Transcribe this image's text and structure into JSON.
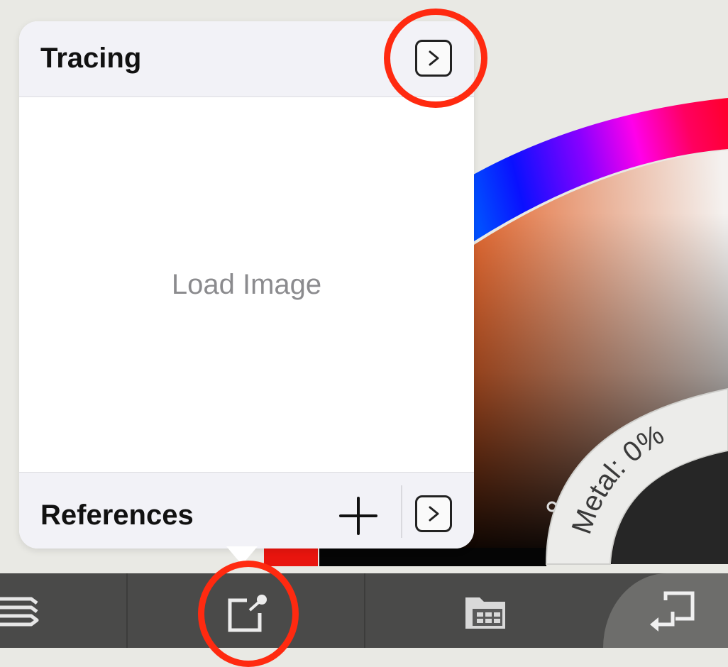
{
  "tracing_panel": {
    "title": "Tracing",
    "load_image_label": "Load Image"
  },
  "references_panel": {
    "title": "References"
  },
  "color_wheel": {
    "metal_label": "Metal: 0%",
    "metal_value_percent": 0
  },
  "toolbar": {
    "items": [
      "layers-icon",
      "reference-icon",
      "gallery-icon",
      "done-icon"
    ]
  },
  "annotations": {
    "color": "#ff2a10"
  }
}
